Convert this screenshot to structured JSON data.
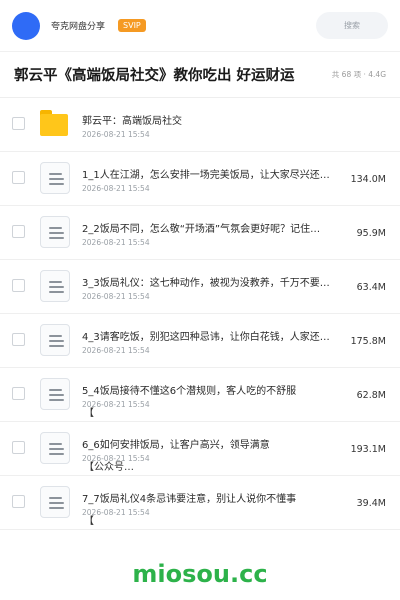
{
  "header": {
    "site_name": "夸克网盘分享",
    "badge": "SVIP",
    "search_placeholder": "搜索"
  },
  "folder": {
    "title": "郭云平《高端饭局社交》教你吃出 好运财运",
    "meta": "共 68 项 · 4.4G"
  },
  "items": [
    {
      "type": "folder",
      "name": "郭云平：高端饭局社交",
      "date": "2026-08-21 15:54",
      "size": "",
      "overflow": ""
    },
    {
      "type": "file",
      "name": "1_1人在江湖，怎么安排一场完美饭局，让大家尽兴还…",
      "date": "2026-08-21 15:54",
      "size": "134.0M",
      "overflow": ""
    },
    {
      "type": "file",
      "name": "2_2饭局不同，怎么敬“开场酒”气氛会更好呢？记住…",
      "date": "2026-08-21 15:54",
      "size": "95.9M",
      "overflow": ""
    },
    {
      "type": "file",
      "name": "3_3饭局礼仪：这七种动作，被视为没教养，千万不要…",
      "date": "2026-08-21 15:54",
      "size": "63.4M",
      "overflow": ""
    },
    {
      "type": "file",
      "name": "4_3请客吃饭，别犯这四种忌讳，让你白花钱，人家还…",
      "date": "2026-08-21 15:54",
      "size": "175.8M",
      "overflow": ""
    },
    {
      "type": "file",
      "name": "5_4饭局接待不懂这6个潜规则，客人吃的不舒服",
      "date": "2026-08-21 15:54",
      "size": "62.8M",
      "overflow": "【"
    },
    {
      "type": "file",
      "name": "6_6如何安排饭局，让客户高兴，领导满意",
      "date": "2026-08-21 15:54",
      "size": "193.1M",
      "overflow": "【公众号…"
    },
    {
      "type": "file",
      "name": "7_7饭局礼仪4条忌讳要注意，别让人说你不懂事",
      "date": "2026-08-21 15:54",
      "size": "39.4M",
      "overflow": "【"
    }
  ],
  "watermark": "miosou.cc",
  "colors": {
    "accent_blue": "#2f6bf6",
    "svip_orange": "#f59a23",
    "folder_yellow": "#ffc61a",
    "watermark_green": "#2db24a"
  }
}
